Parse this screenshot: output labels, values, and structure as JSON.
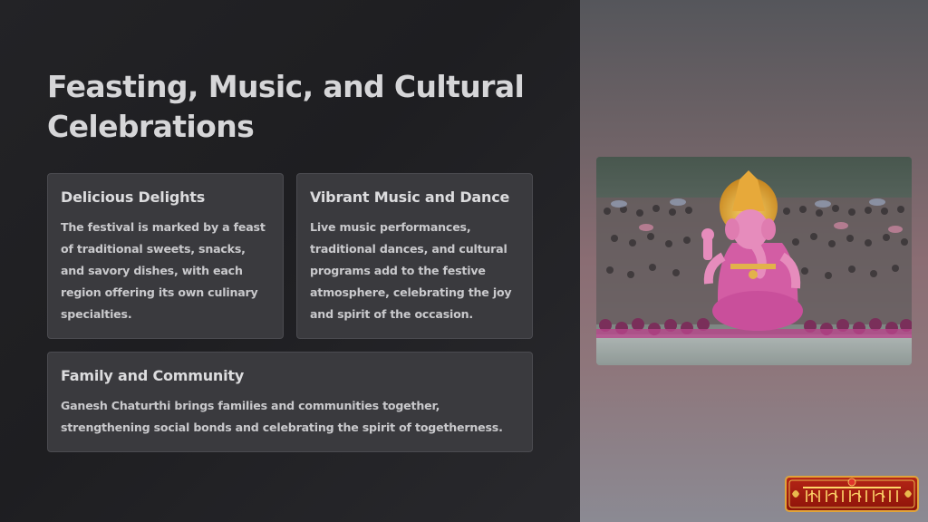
{
  "slide": {
    "title": "Feasting, Music, and Cultural Celebrations",
    "cards": [
      {
        "title": "Delicious Delights",
        "body": "The festival is marked by a feast of traditional sweets, snacks, and savory dishes, with each region offering its own culinary specialties."
      },
      {
        "title": "Vibrant Music and Dance",
        "body": "Live music performances, traditional dances, and cultural programs add to the festive atmosphere, celebrating the joy and spirit of the occasion."
      },
      {
        "title": "Family and Community",
        "body": "Ganesh Chaturthi brings families and communities together, strengthening social bonds and celebrating the spirit of togetherness."
      }
    ]
  },
  "logo": {
    "text": "अष्टविनायक यात्रा",
    "colors": {
      "background": "#a81c10",
      "border": "#e0a43a",
      "text": "#ffd86a"
    }
  },
  "colors": {
    "left_panel": "#232326",
    "card": "#3a3a3e",
    "title_text": "#d6d6d8",
    "body_text": "#c9c9cc"
  }
}
